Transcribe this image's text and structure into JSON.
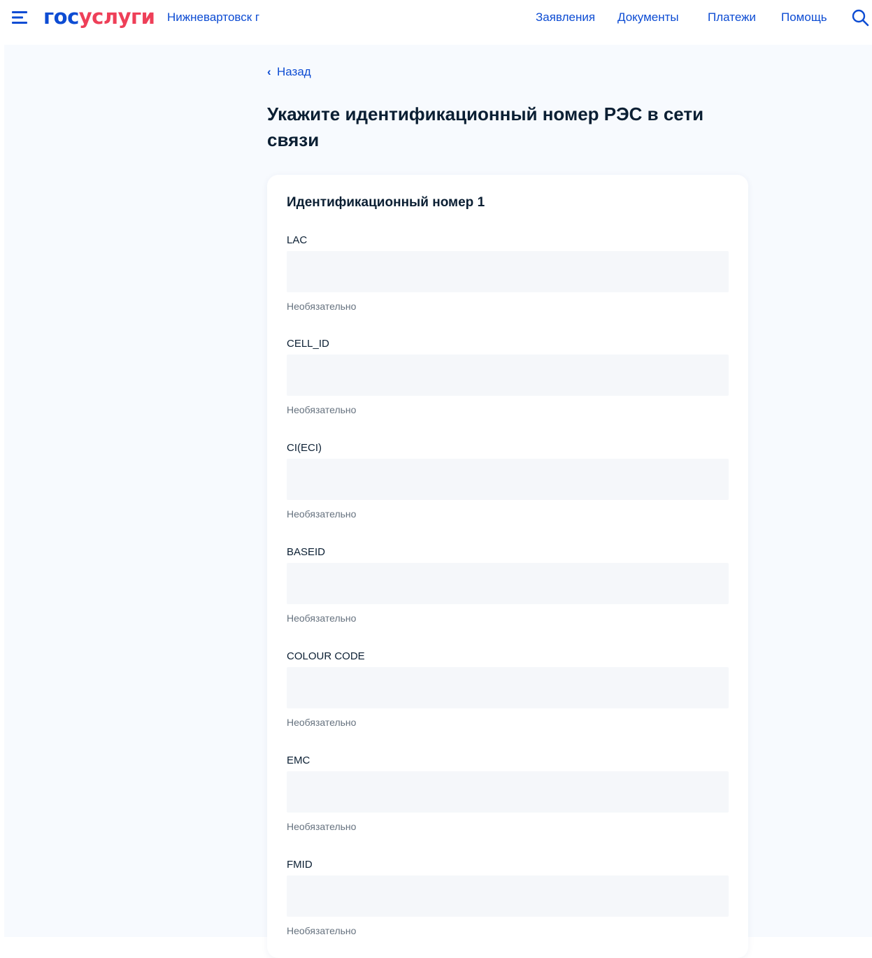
{
  "header": {
    "logo_part1": "гос",
    "logo_part2": "услуги",
    "city": "Нижневартовск г",
    "nav": [
      {
        "label": "Заявления"
      },
      {
        "label": "Документы"
      },
      {
        "label": "Платежи"
      },
      {
        "label": "Помощь"
      }
    ],
    "icons": {
      "menu": "menu-icon",
      "search": "search-icon"
    }
  },
  "page": {
    "back_label": "Назад",
    "title": "Укажите идентификационный номер РЭС в сети связи"
  },
  "card": {
    "title": "Идентификационный номер 1",
    "fields": [
      {
        "label": "LAC",
        "value": "",
        "hint": "Необязательно"
      },
      {
        "label": "CELL_ID",
        "value": "",
        "hint": "Необязательно"
      },
      {
        "label": "CI(ECI)",
        "value": "",
        "hint": "Необязательно"
      },
      {
        "label": "BASEID",
        "value": "",
        "hint": "Необязательно"
      },
      {
        "label": "COLOUR CODE",
        "value": "",
        "hint": "Необязательно"
      },
      {
        "label": "EMC",
        "value": "",
        "hint": "Необязательно"
      },
      {
        "label": "FMID",
        "value": "",
        "hint": "Необязательно"
      }
    ]
  },
  "colors": {
    "primary": "#0d4cd3",
    "logo_accent": "#ee3f58",
    "text": "#0b1f33",
    "hint": "#66727f",
    "input_bg": "#f5f7fa",
    "page_bg": "#f7fafe"
  }
}
